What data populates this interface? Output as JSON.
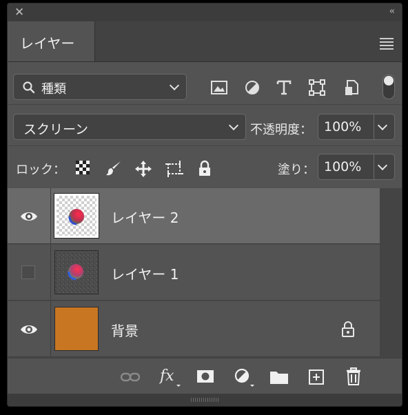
{
  "window": {
    "close_glyph": "✕",
    "collapse_glyph": "‹‹"
  },
  "tabs": [
    {
      "label": "レイヤー"
    }
  ],
  "filter": {
    "kind_label": "種類",
    "icons": [
      "image-filter-icon",
      "adjustment-filter-icon",
      "type-filter-icon",
      "shape-filter-icon",
      "smart-object-filter-icon"
    ],
    "toggle_on": true
  },
  "blend": {
    "mode": "スクリーン",
    "opacity_label": "不透明度：",
    "opacity_value": "100%"
  },
  "lock": {
    "label": "ロック：",
    "icons": [
      "lock-transparent-pixels-icon",
      "lock-image-pixels-icon",
      "lock-position-icon",
      "lock-artboard-icon",
      "lock-all-icon"
    ],
    "fill_label": "塗り：",
    "fill_value": "100%"
  },
  "layers": [
    {
      "name": "レイヤー 2",
      "visible": true,
      "selected": true,
      "locked": false
    },
    {
      "name": "レイヤー 1",
      "visible": false,
      "selected": false,
      "locked": false
    },
    {
      "name": "背景",
      "visible": true,
      "selected": false,
      "locked": true,
      "color": "#c87622"
    }
  ],
  "bottom_icons": [
    "link-layers-icon",
    "fx-icon",
    "add-mask-icon",
    "new-adjustment-icon",
    "new-group-icon",
    "new-layer-icon",
    "delete-icon"
  ],
  "colors": {
    "panel": "#535353",
    "selected_row": "#6a6a6a",
    "background_layer": "#c87622"
  }
}
